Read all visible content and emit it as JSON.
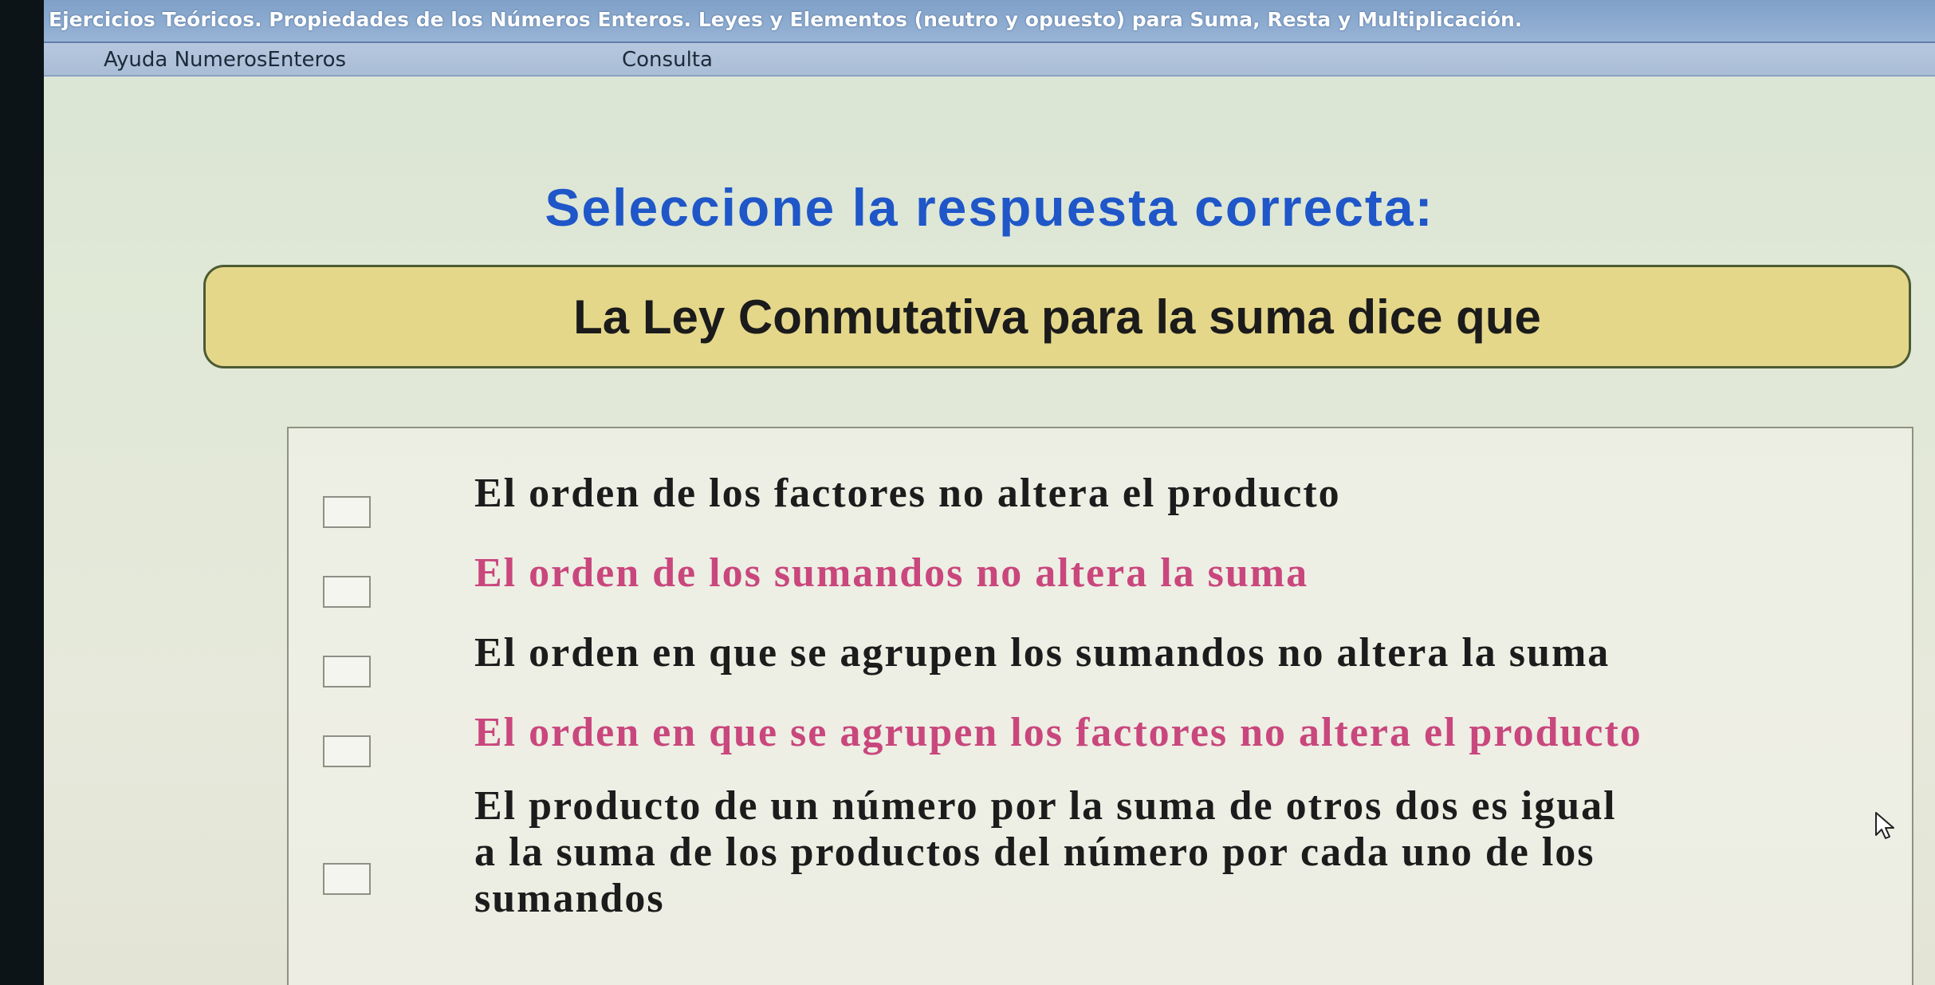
{
  "window": {
    "title": "Ejercicios Teóricos. Propiedades de los Números Enteros. Leyes y Elementos (neutro y opuesto) para Suma, Resta y Multiplicación."
  },
  "menu": {
    "items": [
      {
        "label": "Ayuda NumerosEnteros"
      },
      {
        "label": "Consulta"
      }
    ]
  },
  "main": {
    "heading": "Seleccione la respuesta correcta:",
    "question": "La Ley  Conmutativa  para la suma dice que",
    "options": [
      {
        "lines": [
          "El orden de los factores no altera el producto"
        ],
        "color": "#1c1c1c",
        "checked": false
      },
      {
        "lines": [
          "El orden de los sumandos no altera la suma"
        ],
        "color": "#c9477d",
        "checked": false
      },
      {
        "lines": [
          "El orden en que se agrupen los sumandos no altera la suma"
        ],
        "color": "#1c1c1c",
        "checked": false
      },
      {
        "lines": [
          "El orden en que se agrupen los factores no altera el producto"
        ],
        "color": "#c9477d",
        "checked": false
      },
      {
        "lines": [
          "El producto de un número por la suma de otros dos es igual",
          "a la suma de los productos del número por cada uno de los",
          "sumandos"
        ],
        "color": "#1c1c1c",
        "checked": false
      }
    ]
  },
  "colors": {
    "heading": "#1f56c8",
    "question_box": "#e5d78a",
    "option_dark": "#1c1c1c",
    "option_pink": "#c9477d"
  },
  "icons": {
    "cursor": "mouse-pointer-icon"
  }
}
